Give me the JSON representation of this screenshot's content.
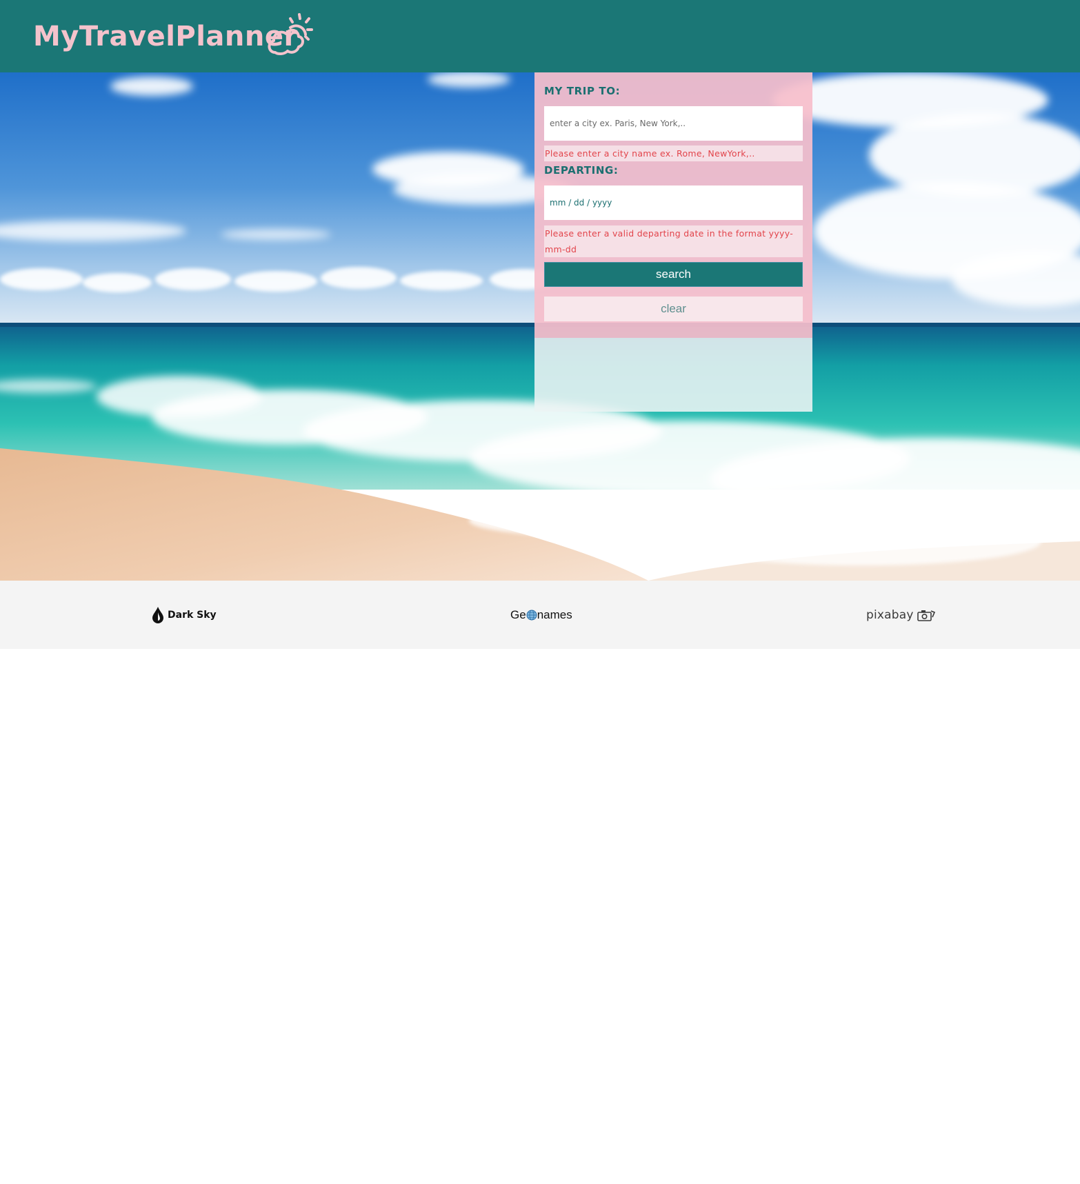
{
  "app": {
    "title": "MyTravelPlanner",
    "logo_icon": "cloud-sun-icon",
    "colors": {
      "header_bg": "#1b7776",
      "brand_text": "#f4c3cc",
      "form_panel_bg": "#f6becb",
      "error_text": "#e2444b",
      "search_button_bg": "#1b7776"
    }
  },
  "hero": {
    "image": "beach-background-photo"
  },
  "trip_form": {
    "destination_label": "MY TRIP TO:",
    "destination_placeholder": "enter a city ex. Paris, New York,..",
    "destination_value": "",
    "destination_error": "Please enter a city name ex. Rome, NewYork,..",
    "departing_label": "DEPARTING:",
    "departing_placeholder": "mm / dd / yyyy",
    "departing_value": "",
    "departing_error": "Please enter a valid departing date in the format yyyy-mm-dd",
    "search_label": "search",
    "clear_label": "clear"
  },
  "footer": {
    "credits": [
      {
        "name": "Dark Sky",
        "icon": "darksky-drop-icon"
      },
      {
        "name_prefix": "Ge",
        "name_suffix": "names",
        "icon": "globe-icon"
      },
      {
        "name": "pixabay",
        "icon": "camera-icon"
      }
    ]
  }
}
